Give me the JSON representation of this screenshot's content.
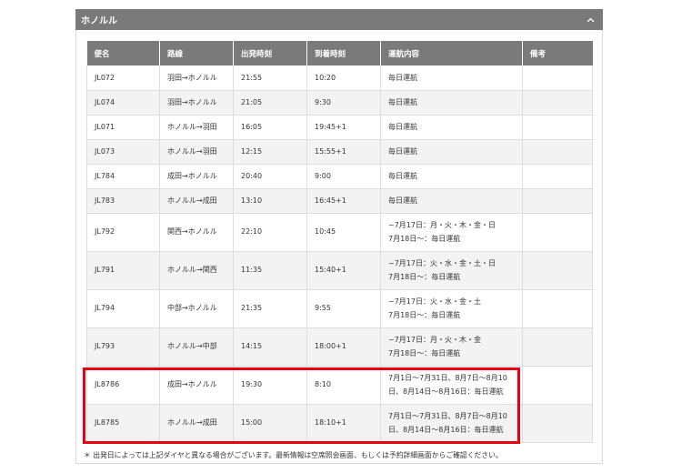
{
  "panel": {
    "title": "ホノルル",
    "collapse_icon": "chevron-up-icon"
  },
  "table": {
    "headers": [
      "便名",
      "路線",
      "出発時刻",
      "到着時刻",
      "運航内容",
      "備考"
    ],
    "rows": [
      {
        "flight": "JL072",
        "route": "羽田→ホノルル",
        "dep": "21:55",
        "arr": "10:20",
        "ops": [
          "毎日運航"
        ],
        "note": ""
      },
      {
        "flight": "JL074",
        "route": "羽田→ホノルル",
        "dep": "21:05",
        "arr": "9:30",
        "ops": [
          "毎日運航"
        ],
        "note": ""
      },
      {
        "flight": "JL071",
        "route": "ホノルル→羽田",
        "dep": "16:05",
        "arr": "19:45+1",
        "ops": [
          "毎日運航"
        ],
        "note": ""
      },
      {
        "flight": "JL073",
        "route": "ホノルル→羽田",
        "dep": "12:15",
        "arr": "15:55+1",
        "ops": [
          "毎日運航"
        ],
        "note": ""
      },
      {
        "flight": "JL784",
        "route": "成田→ホノルル",
        "dep": "20:40",
        "arr": "9:00",
        "ops": [
          "毎日運航"
        ],
        "note": ""
      },
      {
        "flight": "JL783",
        "route": "ホノルル→成田",
        "dep": "13:10",
        "arr": "16:45+1",
        "ops": [
          "毎日運航"
        ],
        "note": ""
      },
      {
        "flight": "JL792",
        "route": "関西→ホノルル",
        "dep": "22:10",
        "arr": "10:45",
        "ops": [
          "~7月17日：月・火・木・金・日",
          "7月18日～：毎日運航"
        ],
        "note": ""
      },
      {
        "flight": "JL791",
        "route": "ホノルル→関西",
        "dep": "11:35",
        "arr": "15:40+1",
        "ops": [
          "~7月17日：火・水・金・土・日",
          "7月18日～：毎日運航"
        ],
        "note": ""
      },
      {
        "flight": "JL794",
        "route": "中部→ホノルル",
        "dep": "21:35",
        "arr": "9:55",
        "ops": [
          "~7月17日：火・水・金・土",
          "7月18日～：毎日運航"
        ],
        "note": ""
      },
      {
        "flight": "JL793",
        "route": "ホノルル→中部",
        "dep": "14:15",
        "arr": "18:00+1",
        "ops": [
          "~7月17日：月・火・木・金",
          "7月18日～：毎日運航"
        ],
        "note": ""
      },
      {
        "flight": "JL8786",
        "route": "成田→ホノルル",
        "dep": "19:30",
        "arr": "8:10",
        "ops": [
          "7月1日～7月31日、8月7日～8月10",
          "日、8月14日～8月16日：毎日運航"
        ],
        "note": ""
      },
      {
        "flight": "JL8785",
        "route": "ホノルル→成田",
        "dep": "15:00",
        "arr": "18:10+1",
        "ops": [
          "7月1日～7月31日、8月7日～8月10",
          "日、8月14日～8月16日：毎日運航"
        ],
        "note": ""
      }
    ]
  },
  "footnote": "＊ 出発日によっては上記ダイヤと異なる場合がございます。最新情報は空席照会画面、もしくは予約詳細画面からご確認ください。",
  "colors": {
    "header_bg": "#7a7a7a",
    "highlight": "#e60012"
  }
}
